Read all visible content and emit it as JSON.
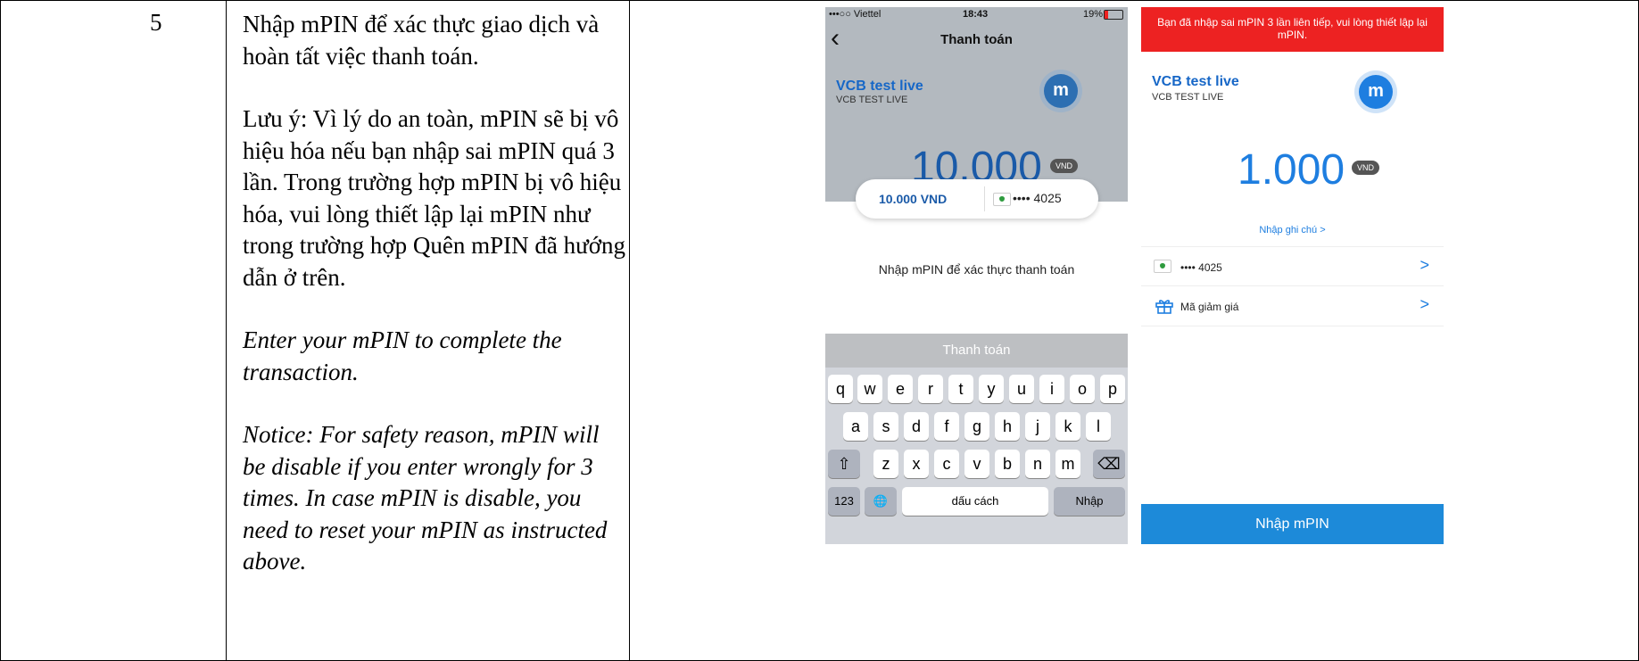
{
  "row": {
    "number": "5",
    "paragraphs_vi": [
      "Nhập mPIN để xác thực giao dịch và hoàn tất việc thanh toán.",
      "Lưu ý: Vì lý do an toàn, mPIN sẽ bị vô hiệu hóa nếu bạn nhập sai mPIN quá 3 lần. Trong trường hợp mPIN bị vô hiệu hóa, vui lòng thiết lập lại mPIN như trong trường hợp Quên mPIN đã hướng dẫn ở trên."
    ],
    "paragraphs_en": [
      "Enter your mPIN to complete the transaction.",
      "Notice: For safety reason, mPIN will be disable if you enter wrongly for 3 times. In case mPIN is disable, you need to reset your mPIN as instructed above."
    ]
  },
  "screen1": {
    "status": {
      "carrier": "•••○○ Viettel",
      "time": "18:43",
      "battery": "19%"
    },
    "back_icon": "chevron-left-icon",
    "nav_title": "Thanh toán",
    "merchant_name": "VCB test live",
    "merchant_sub": "VCB TEST LIVE",
    "logo_letter": "m",
    "amount": "10.000",
    "currency_badge": "VND",
    "pill_amount": "10.000 VND",
    "pill_card": "•••• 4025",
    "prompt": "Nhập mPIN để xác thực thanh toán",
    "keyboard_title": "Thanh toán",
    "keys_row1": [
      "q",
      "w",
      "e",
      "r",
      "t",
      "y",
      "u",
      "i",
      "o",
      "p"
    ],
    "keys_row2": [
      "a",
      "s",
      "d",
      "f",
      "g",
      "h",
      "j",
      "k",
      "l"
    ],
    "keys_row3": [
      "z",
      "x",
      "c",
      "v",
      "b",
      "n",
      "m"
    ],
    "key_shift": "⇧",
    "key_delete": "⌫",
    "key_123": "123",
    "key_globe": "🌐",
    "key_space": "dấu cách",
    "key_enter": "Nhập"
  },
  "screen2": {
    "error_message": "Bạn đã nhập sai mPIN 3 lần liên tiếp, vui lòng thiết lập lại mPIN.",
    "merchant_name": "VCB test live",
    "merchant_sub": "VCB TEST LIVE",
    "logo_letter": "m",
    "amount": "1.000",
    "currency_badge": "VND",
    "note_link": "Nhập ghi chú >",
    "card_label": "•••• 4025",
    "discount_label": "Mã giảm giá",
    "chevron": ">",
    "button_label": "Nhập mPIN",
    "colors": {
      "accent": "#1e7ee0",
      "error": "#ed2222",
      "button": "#1d8ad9"
    }
  }
}
